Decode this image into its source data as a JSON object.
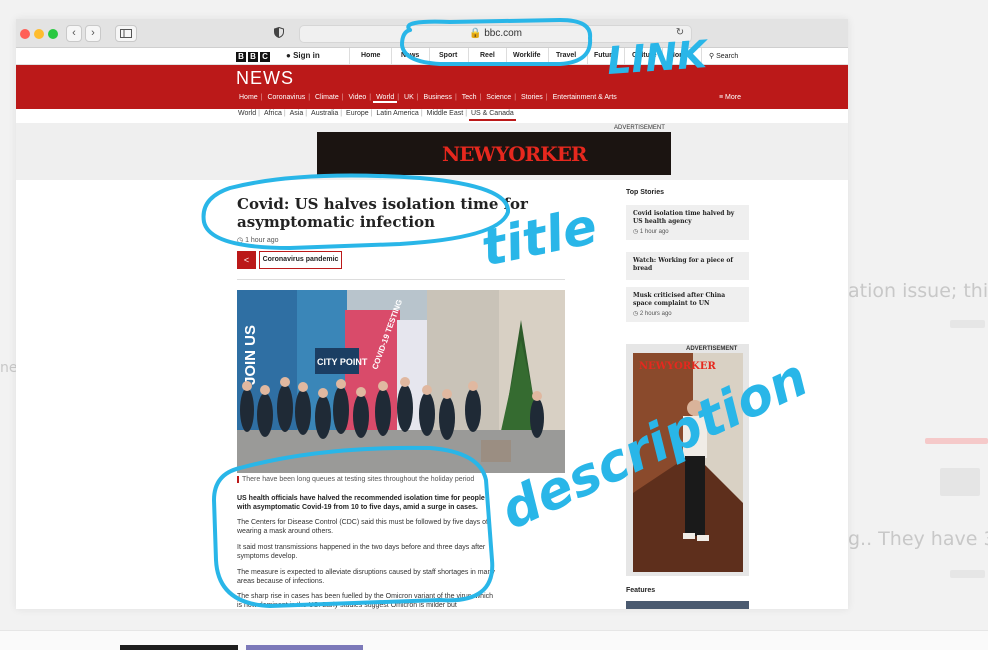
{
  "background": {
    "left_snippet": "ne",
    "snippet_1": "ation issue; this",
    "snippet_2": "g.. They have 3"
  },
  "browser": {
    "address": "bbc.com"
  },
  "bbc_header": {
    "signin": "Sign in",
    "nav": [
      "Home",
      "News",
      "Sport",
      "Reel",
      "Worklife",
      "Travel",
      "Future",
      "Culture",
      "More"
    ],
    "search": "Search"
  },
  "news": {
    "title": "NEWS",
    "nav": [
      "Home",
      "Coronavirus",
      "Climate",
      "Video",
      "World",
      "UK",
      "Business",
      "Tech",
      "Science",
      "Stories",
      "Entertainment & Arts"
    ],
    "active": "World",
    "more": "≡ More",
    "subnav": [
      "World",
      "Africa",
      "Asia",
      "Australia",
      "Europe",
      "Latin America",
      "Middle East",
      "US & Canada"
    ],
    "subnav_active": "US & Canada",
    "advertisement": "ADVERTISEMENT",
    "banner_logo": "NEWYORKER"
  },
  "article": {
    "headline": "Covid: US halves isolation time for asymptomatic infection",
    "time": "1 hour ago",
    "topic": "Coronavirus pandemic",
    "caption": "There have been long queues at testing sites throughout the holiday period",
    "photo_signs": {
      "sign1": "JOIN US",
      "sign2": "CITY POINT",
      "sign3": "COVID-19 TESTING"
    },
    "paragraphs": [
      "US health officials have halved the recommended isolation time for people with asymptomatic Covid-19 from 10 to five days, amid a surge in cases.",
      "The Centers for Disease Control (CDC) said this must be followed by five days of wearing a mask around others.",
      "It said most transmissions happened in the two days before and three days after symptoms develop.",
      "The measure is expected to alleviate disruptions caused by staff shortages in many areas because of infections.",
      "The sharp rise in cases has been fuelled by the Omicron variant of the virus, which is now dominant in the US. Early studies suggest Omicron is milder but"
    ]
  },
  "sidebar": {
    "heading": "Top Stories",
    "stories": [
      {
        "title": "Covid isolation time halved by US health agency",
        "time": "1 hour ago"
      },
      {
        "title": "Watch: Working for a piece of bread",
        "time": ""
      },
      {
        "title": "Musk criticised after China space complaint to UN",
        "time": "2 hours ago"
      }
    ],
    "advertisement": "ADVERTISEMENT",
    "ad_logo": "NEWYORKER",
    "features": "Features"
  },
  "annotations": {
    "link": "LINK",
    "title": "title",
    "description": "description"
  },
  "colors": {
    "bbc_red": "#bb1919",
    "annotation_blue": "#29b6e8"
  }
}
